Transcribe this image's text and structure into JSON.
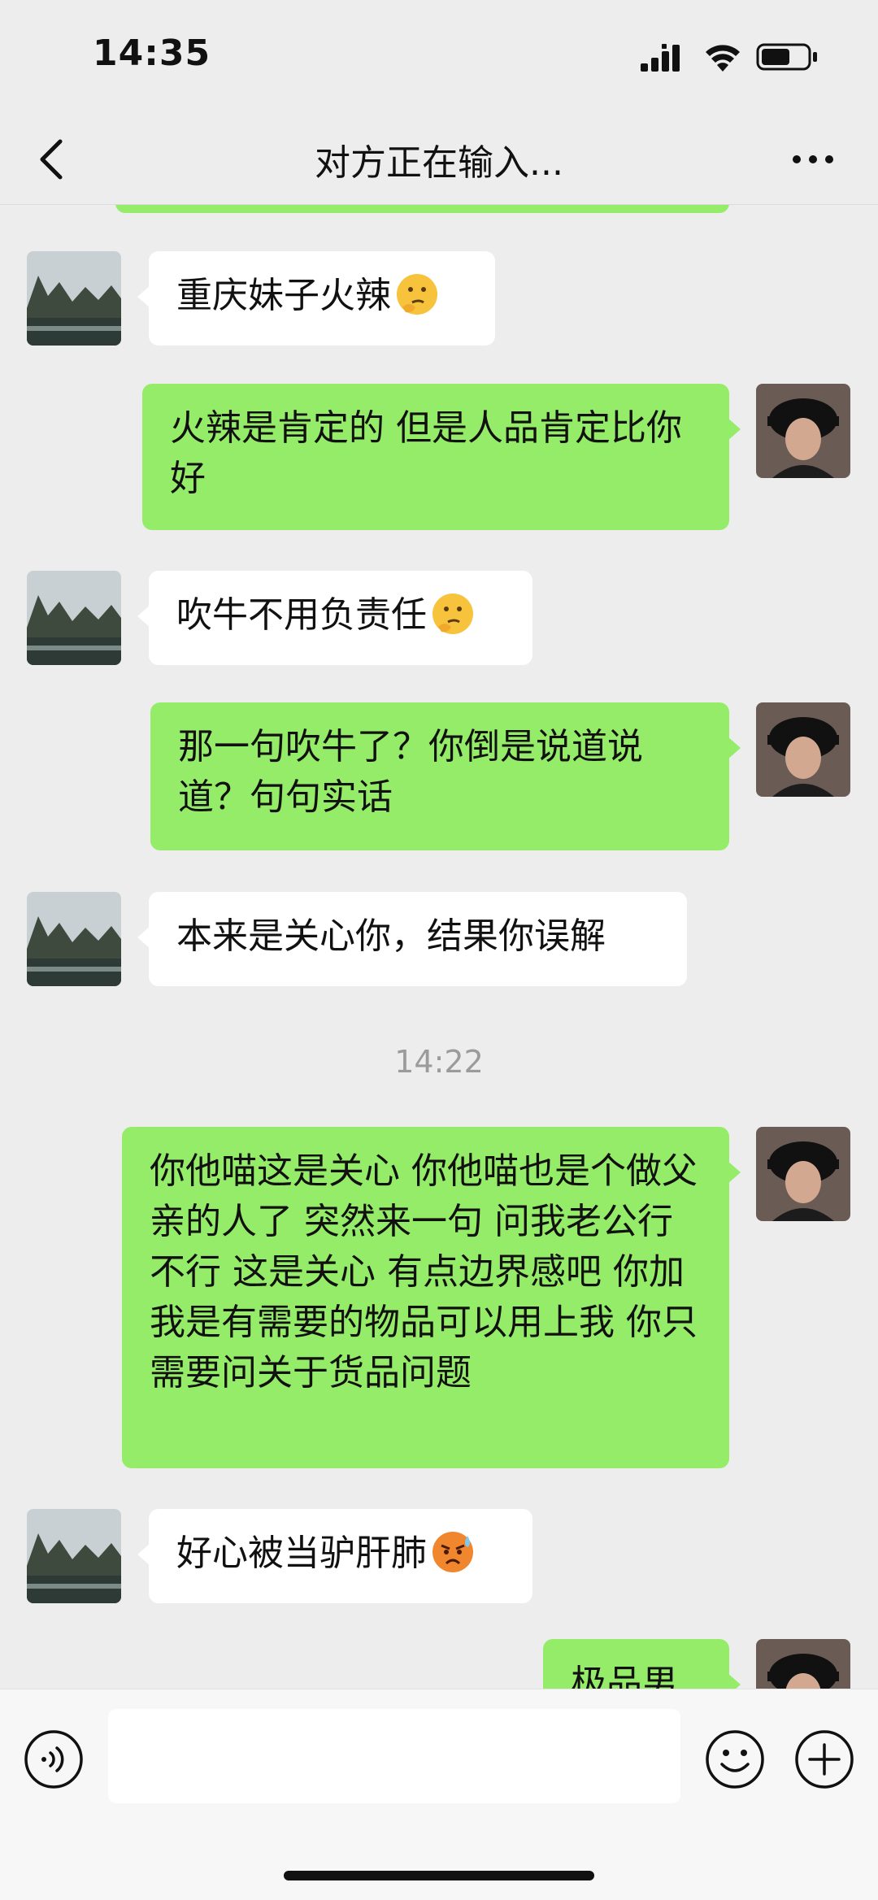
{
  "status_bar": {
    "time": "14:35"
  },
  "nav": {
    "title": "对方正在输入..."
  },
  "messages": [
    {
      "side": "in",
      "text": "重庆妹子火辣",
      "emoji": "thinking-face-emoji"
    },
    {
      "side": "out",
      "text": "火辣是肯定的 但是人品肯定比你好"
    },
    {
      "side": "in",
      "text": "吹牛不用负责任",
      "emoji": "thinking-face-emoji"
    },
    {
      "side": "out",
      "text": "那一句吹牛了？你倒是说道说道？句句实话"
    },
    {
      "side": "in",
      "text": "本来是关心你，结果你误解"
    },
    {
      "side": "out",
      "text": "你他喵这是关心 你他喵也是个做父亲的人了 突然来一句 问我老公行不行  这是关心 有点边界感吧 你加我是有需要的物品可以用上我 你只需要问关于货品问题"
    },
    {
      "side": "in",
      "text": "好心被当驴肝肺",
      "emoji": "angry-sweat-face-emoji"
    },
    {
      "side": "out",
      "text": "极品男"
    }
  ],
  "time_divider": "14:22",
  "colors": {
    "background": "#ededed",
    "outgoing_bubble": "#95ec69",
    "incoming_bubble": "#ffffff",
    "timestamp": "#9b9b9b"
  },
  "input_bar": {
    "value": ""
  }
}
